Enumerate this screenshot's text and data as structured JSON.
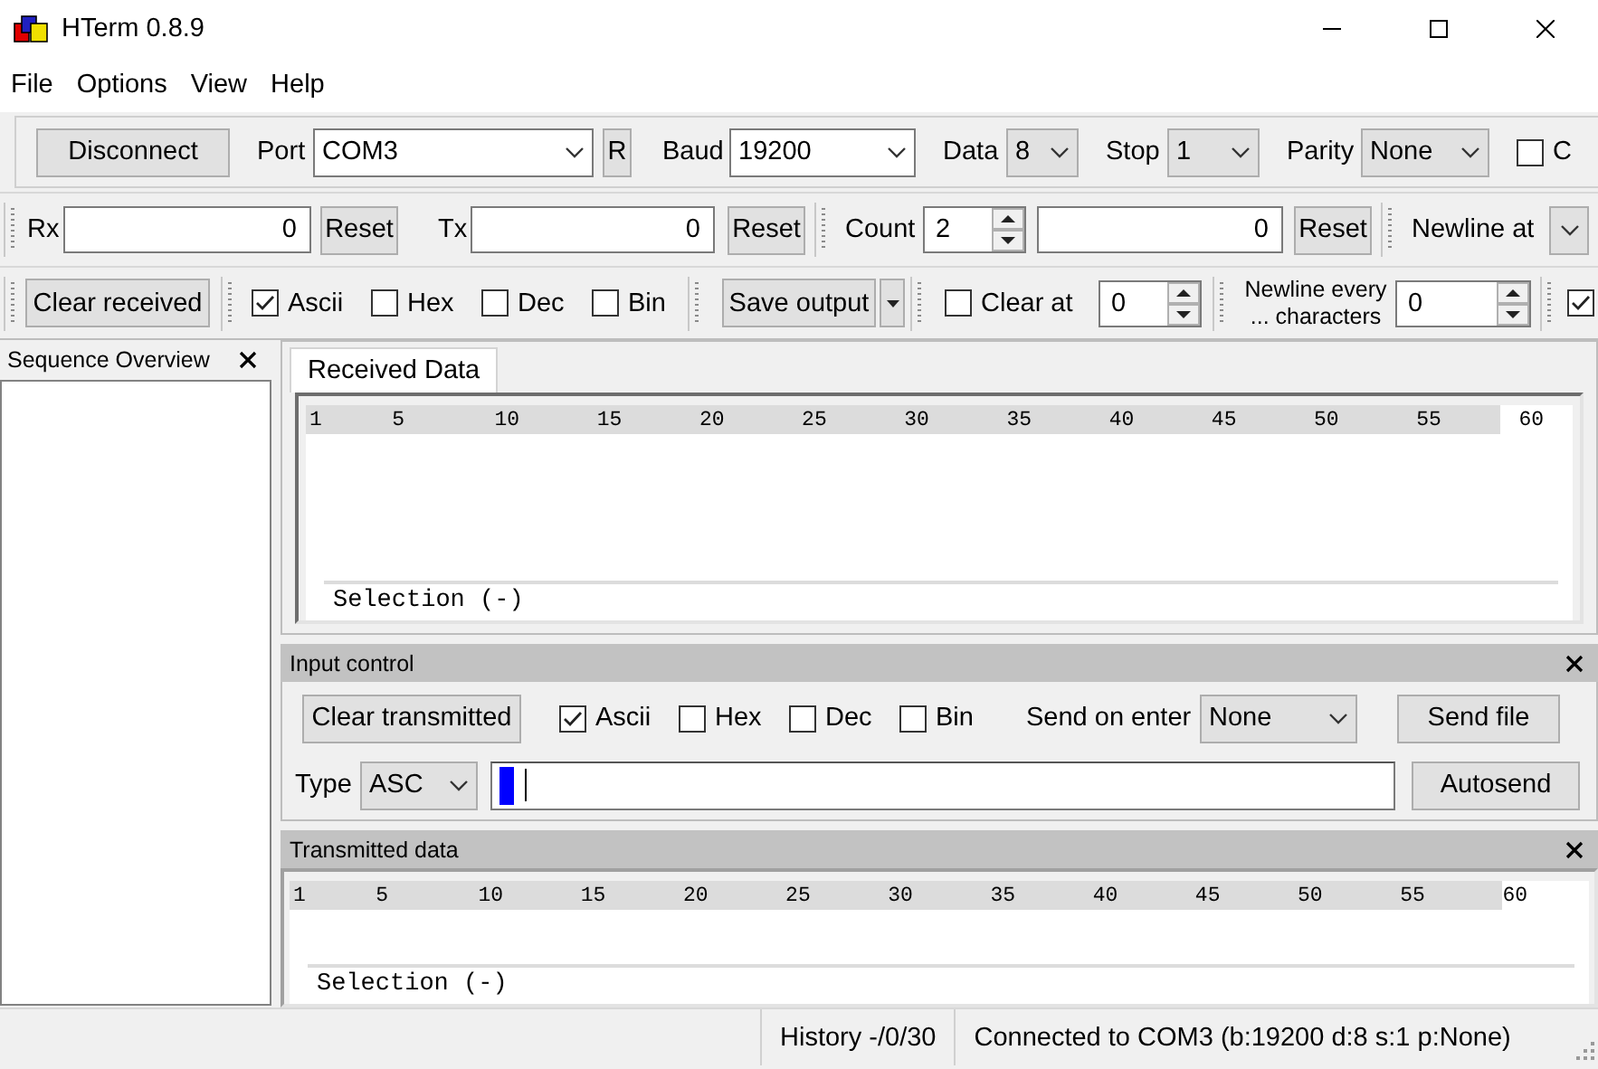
{
  "window": {
    "title": "HTerm 0.8.9"
  },
  "menu": [
    "File",
    "Options",
    "View",
    "Help"
  ],
  "toolbars": [
    {
      "items": [
        {
          "kind": "button",
          "label": "Disconnect"
        },
        {
          "kind": "label",
          "text": "Port"
        },
        {
          "kind": "edit_combo",
          "value": "COM3"
        },
        {
          "kind": "button",
          "label": "R"
        },
        {
          "kind": "label",
          "text": "Baud"
        },
        {
          "kind": "edit_combo",
          "value": "19200"
        },
        {
          "kind": "label",
          "text": "Data"
        },
        {
          "kind": "combo",
          "value": "8"
        },
        {
          "kind": "label",
          "text": "Stop"
        },
        {
          "kind": "combo",
          "value": "1"
        },
        {
          "kind": "label",
          "text": "Parity"
        },
        {
          "kind": "combo",
          "value": "None"
        },
        {
          "kind": "check",
          "label": "C",
          "checked": false
        }
      ]
    },
    {
      "items": [
        {
          "kind": "grip"
        },
        {
          "kind": "label",
          "text": "Rx"
        },
        {
          "kind": "field",
          "value": "0"
        },
        {
          "kind": "button",
          "label": "Reset"
        },
        {
          "kind": "label",
          "text": "Tx"
        },
        {
          "kind": "field",
          "value": "0"
        },
        {
          "kind": "button",
          "label": "Reset"
        },
        {
          "kind": "grip"
        },
        {
          "kind": "label",
          "text": "Count"
        },
        {
          "kind": "spin",
          "value": "2"
        },
        {
          "kind": "field",
          "value": "0"
        },
        {
          "kind": "button",
          "label": "Reset"
        },
        {
          "kind": "grip"
        },
        {
          "kind": "label",
          "text": "Newline at"
        },
        {
          "kind": "combo"
        }
      ]
    },
    {
      "items": [
        {
          "kind": "grip"
        },
        {
          "kind": "button",
          "label": "Clear received"
        },
        {
          "kind": "grip"
        },
        {
          "kind": "check",
          "label": "Ascii",
          "checked": true
        },
        {
          "kind": "check",
          "label": "Hex",
          "checked": false
        },
        {
          "kind": "check",
          "label": "Dec",
          "checked": false
        },
        {
          "kind": "check",
          "label": "Bin",
          "checked": false
        },
        {
          "kind": "grip"
        },
        {
          "kind": "split",
          "label": "Save output"
        },
        {
          "kind": "grip"
        },
        {
          "kind": "check",
          "label": "Clear at",
          "checked": false
        },
        {
          "kind": "spin",
          "value": "0"
        },
        {
          "kind": "grip"
        },
        {
          "kind": "caption",
          "text": "Newline every ... characters"
        },
        {
          "kind": "spin",
          "value": "0"
        },
        {
          "kind": "grip"
        },
        {
          "kind": "small_check",
          "checked": true
        }
      ]
    }
  ],
  "sidebar": {
    "title": "Sequence Overview"
  },
  "received": {
    "tabs": [
      {
        "label": "Received Data",
        "selected": true
      }
    ],
    "ruler": [
      "1",
      "5",
      "10",
      "15",
      "20",
      "25",
      "30",
      "35",
      "40",
      "45",
      "50",
      "55",
      "60"
    ],
    "selection": "Selection (-)"
  },
  "input_control": {
    "title": "Input control",
    "rows": [
      {
        "items": [
          {
            "kind": "button",
            "label": "Clear transmitted"
          },
          {
            "kind": "check",
            "label": "Ascii",
            "checked": true
          },
          {
            "kind": "check",
            "label": "Hex",
            "checked": false
          },
          {
            "kind": "check",
            "label": "Dec",
            "checked": false
          },
          {
            "kind": "check",
            "label": "Bin",
            "checked": false
          },
          {
            "kind": "label",
            "text": "Send on enter"
          },
          {
            "kind": "combo",
            "value": "None"
          },
          {
            "kind": "button",
            "label": "Send file"
          }
        ]
      },
      {
        "items": [
          {
            "kind": "label",
            "text": "Type"
          },
          {
            "kind": "combo",
            "value": "ASC"
          },
          {
            "kind": "input"
          },
          {
            "kind": "button",
            "label": "Autosend"
          }
        ]
      }
    ]
  },
  "transmitted": {
    "title": "Transmitted data",
    "ruler": [
      "1",
      "5",
      "10",
      "15",
      "20",
      "25",
      "30",
      "35",
      "40",
      "45",
      "50",
      "55",
      "60"
    ],
    "selection": "Selection (-)"
  },
  "status_bar": [
    "History -/0/30",
    "Connected to COM3 (b:19200 d:8 s:1 p:None)"
  ]
}
